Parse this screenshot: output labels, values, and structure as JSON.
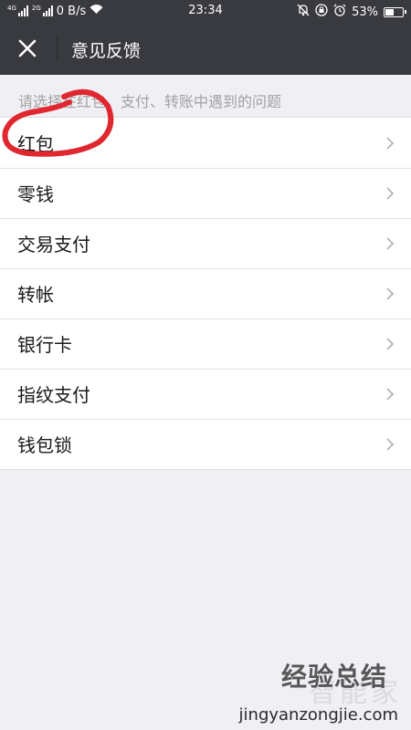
{
  "status_bar": {
    "net_speed": "0 B/s",
    "time": "23:34",
    "battery_level": "53%",
    "battery_fraction": 0.53,
    "sim1_tag": "4G",
    "sim2_tag": "2G"
  },
  "nav": {
    "title": "意见反馈",
    "close_icon": "close-icon"
  },
  "hint": "请选择在红包、支付、转账中遇到的问题",
  "items": [
    {
      "label": "红包"
    },
    {
      "label": "零钱"
    },
    {
      "label": "交易支付"
    },
    {
      "label": "转帐"
    },
    {
      "label": "银行卡"
    },
    {
      "label": "指纹支付"
    },
    {
      "label": "钱包锁"
    }
  ],
  "watermark": {
    "logo": "智能家",
    "cn": "经验总结",
    "cn_accent": "总",
    "url": "jingyanzongjie.com"
  },
  "colors": {
    "header": "#393a3f",
    "background": "#efeff4",
    "annotation": "#e0262f"
  }
}
